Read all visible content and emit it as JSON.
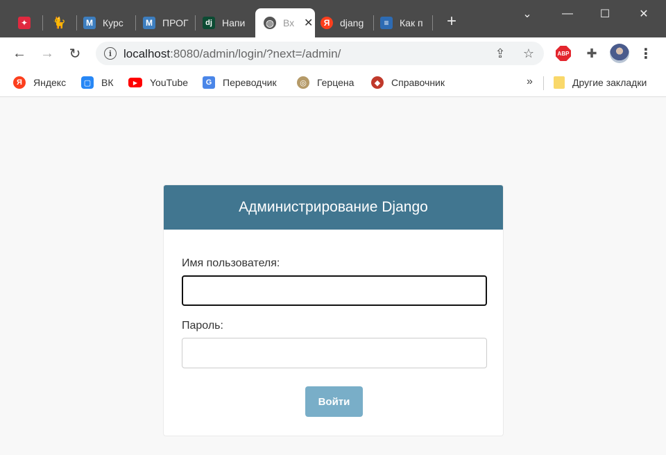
{
  "browser": {
    "tabs": [
      {
        "icon": "dice-icon",
        "title": "",
        "color": "#e0293f"
      },
      {
        "icon": "cat-icon",
        "title": "",
        "color": "#333333"
      },
      {
        "icon": "m-icon",
        "title": "Курс",
        "color": "#3d7ebf"
      },
      {
        "icon": "m-icon",
        "title": "ПРОГ",
        "color": "#3d7ebf"
      },
      {
        "icon": "dj-icon",
        "title": "Напи",
        "color": "#0c4b33"
      },
      {
        "icon": "globe-icon",
        "title": "Вх",
        "color": "#555555"
      },
      {
        "icon": "yandex-icon",
        "title": "djang",
        "color": "#fc3f1d"
      },
      {
        "icon": "stackoverflow-icon",
        "title": "Как п",
        "color": "#2d6bb3"
      }
    ],
    "fav_glyphs": [
      "✦",
      "",
      "M",
      "M",
      "dj",
      "◍",
      "Я",
      "≡"
    ],
    "address": {
      "host": "localhost",
      "path": ":8080/admin/login/?next=/admin/"
    },
    "bookmarks": [
      {
        "label": "Яндекс",
        "icon": "yandex-icon",
        "color": "#fc3f1d",
        "glyph": "Я"
      },
      {
        "label": "ВК",
        "icon": "vk-icon",
        "color": "#2787f5",
        "glyph": "▢"
      },
      {
        "label": "YouTube",
        "icon": "youtube-icon",
        "color": "#ff0000",
        "glyph": "▶"
      },
      {
        "label": "Переводчик",
        "icon": "translate-icon",
        "color": "#4a86e8",
        "glyph": "G"
      },
      {
        "label": "Герцена",
        "icon": "herzen-seal-icon",
        "color": "#b59a68",
        "glyph": "◎"
      },
      {
        "label": "Справочник",
        "icon": "reference-icon",
        "color": "#c0392b",
        "glyph": "◆"
      }
    ],
    "other_bookmarks": "Другие закладки",
    "new_tab": "+",
    "abp": "ABP"
  },
  "login": {
    "header": "Администрирование Django",
    "username_label": "Имя пользователя:",
    "username_value": "",
    "password_label": "Пароль:",
    "password_value": "",
    "submit_label": "Войти",
    "header_color": "#417690",
    "button_color": "#79aec8"
  }
}
